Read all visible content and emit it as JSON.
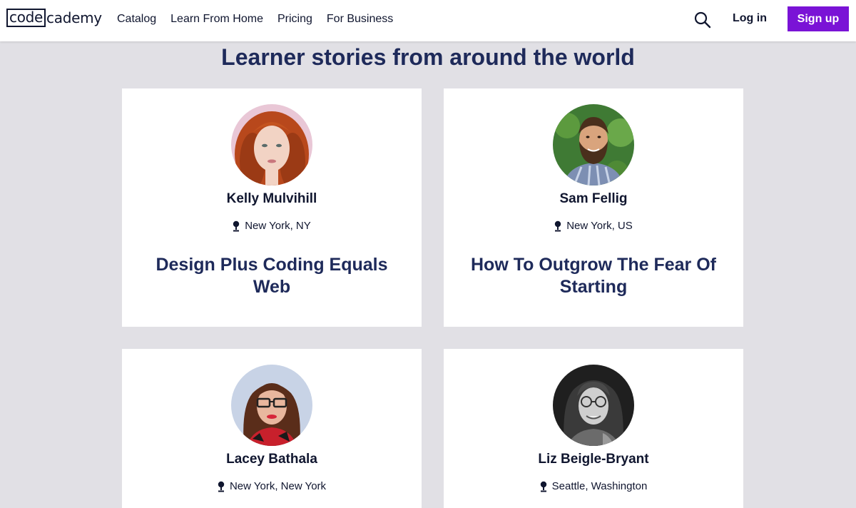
{
  "header": {
    "logo": {
      "boxed": "code",
      "rest": "cademy"
    },
    "nav": [
      {
        "label": "Catalog"
      },
      {
        "label": "Learn From Home"
      },
      {
        "label": "Pricing"
      },
      {
        "label": "For Business"
      }
    ],
    "search_icon": "search-icon",
    "login_label": "Log in",
    "signup_label": "Sign up"
  },
  "page_title": "Learner stories from around the world",
  "colors": {
    "brand_purple": "#7a13d6",
    "heading_navy": "#1e2a5a",
    "text_dark": "#10162f",
    "page_bg": "#e1e0e5",
    "card_bg": "#ffffff"
  },
  "cards": [
    {
      "name": "Kelly Mulvihill",
      "location": "New York, NY",
      "story": "Design Plus Coding Equals Web",
      "avatar": "portrait-red-hair-woman"
    },
    {
      "name": "Sam Fellig",
      "location": "New York, US",
      "story": "How To Outgrow The Fear Of Starting",
      "avatar": "portrait-bearded-man-plaid"
    },
    {
      "name": "Lacey Bathala",
      "location": "New York, New York",
      "story": "",
      "avatar": "portrait-woman-glasses-red"
    },
    {
      "name": "Liz Beigle-Bryant",
      "location": "Seattle, Washington",
      "story": "",
      "avatar": "portrait-woman-glasses-bw"
    }
  ]
}
